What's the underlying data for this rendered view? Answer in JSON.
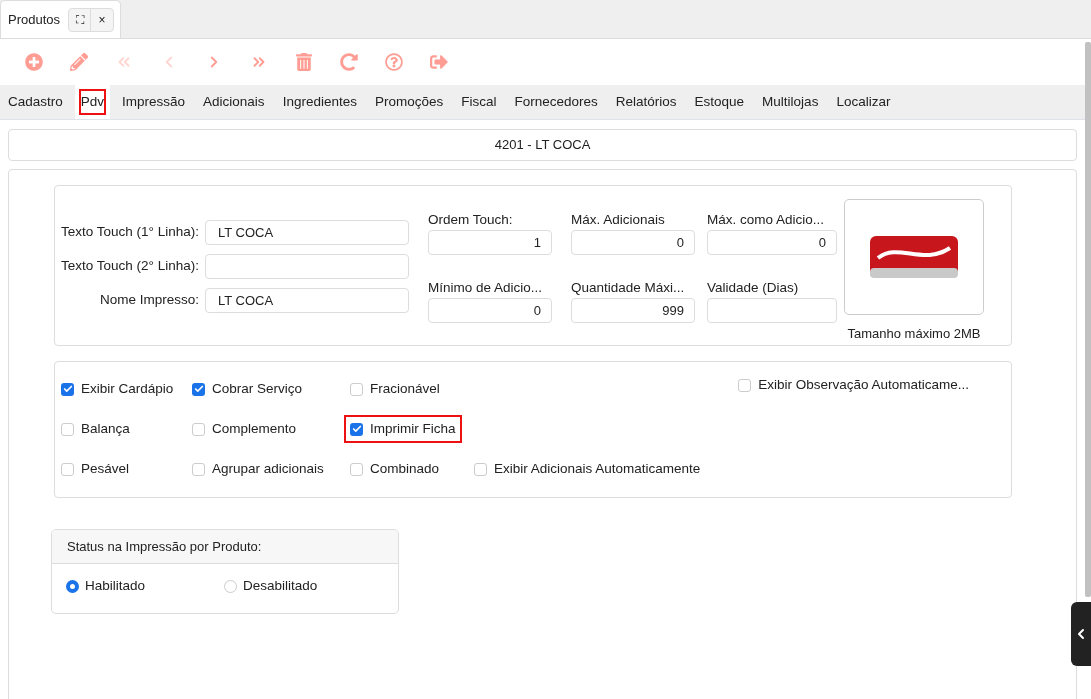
{
  "window_tab": {
    "title": "Produtos",
    "buttons": [
      "⛶",
      "×"
    ]
  },
  "toolbar": [
    {
      "disabled": false
    },
    {
      "disabled": false
    },
    {
      "disabled": true
    },
    {
      "disabled": true
    },
    {
      "disabled": false
    },
    {
      "disabled": false
    },
    {
      "disabled": false
    },
    {
      "disabled": false
    },
    {
      "disabled": false
    },
    {
      "disabled": false
    }
  ],
  "tabs": [
    {
      "label": "Cadastro",
      "selected": false,
      "highlighted": false
    },
    {
      "label": "Pdv",
      "selected": true,
      "highlighted": true
    },
    {
      "label": "Impressão",
      "selected": false,
      "highlighted": false
    },
    {
      "label": "Adicionais",
      "selected": false,
      "highlighted": false
    },
    {
      "label": "Ingredientes",
      "selected": false,
      "highlighted": false
    },
    {
      "label": "Promoções",
      "selected": false,
      "highlighted": false
    },
    {
      "label": "Fiscal",
      "selected": false,
      "highlighted": false
    },
    {
      "label": "Fornecedores",
      "selected": false,
      "highlighted": false
    },
    {
      "label": "Relatórios",
      "selected": false,
      "highlighted": false
    },
    {
      "label": "Estoque",
      "selected": false,
      "highlighted": false
    },
    {
      "label": "Multilojas",
      "selected": false,
      "highlighted": false
    },
    {
      "label": "Localizar",
      "selected": false,
      "highlighted": false
    }
  ],
  "record_title": "4201 - LT COCA",
  "text_fields": [
    {
      "label": "Texto Touch (1° Linha):",
      "value": "LT COCA"
    },
    {
      "label": "Texto Touch (2° Linha):"
    },
    {
      "label": "Nome Impresso:",
      "value": "LT COCA"
    }
  ],
  "number_fields": [
    {
      "label": "Ordem Touch:",
      "value": "1"
    },
    {
      "label": "Máx. Adicionais",
      "value": "0"
    },
    {
      "label": "Máx. como Adicio...",
      "value": "0"
    },
    {
      "label": "Mínimo de Adicio...",
      "value": "0"
    },
    {
      "label": "Quantidade Máxi...",
      "value": "999"
    },
    {
      "label": "Validade (Dias)"
    }
  ],
  "image": {
    "caption": "Tamanho máximo 2MB"
  },
  "options": {
    "rows": [
      [
        {
          "label": "Exibir Cardápio",
          "checked": true,
          "highlighted": false
        },
        {
          "label": "Cobrar Serviço",
          "checked": true,
          "highlighted": false
        },
        {
          "label": "Fracionável",
          "checked": false,
          "highlighted": false
        }
      ],
      [
        {
          "label": "Balança",
          "checked": false,
          "highlighted": false
        },
        {
          "label": "Complemento",
          "checked": false,
          "highlighted": false
        },
        {
          "label": "Imprimir Ficha",
          "checked": true,
          "highlighted": true
        }
      ],
      [
        {
          "label": "Pesável",
          "checked": false,
          "highlighted": false
        },
        {
          "label": "Agrupar adicionais",
          "checked": false,
          "highlighted": false
        },
        {
          "label": "Combinado",
          "checked": false,
          "highlighted": false
        },
        {
          "label": "Exibir Adicionais Automaticamente",
          "checked": false,
          "highlighted": false
        }
      ]
    ],
    "side": {
      "label": "Exibir Observação  Automaticame...",
      "checked": false,
      "highlighted": false
    }
  },
  "print_status": {
    "title": "Status na Impressão por Produto:",
    "choices": [
      {
        "label": "Habilitado",
        "selected": true
      },
      {
        "label": "Desabilitado",
        "selected": false
      }
    ]
  }
}
